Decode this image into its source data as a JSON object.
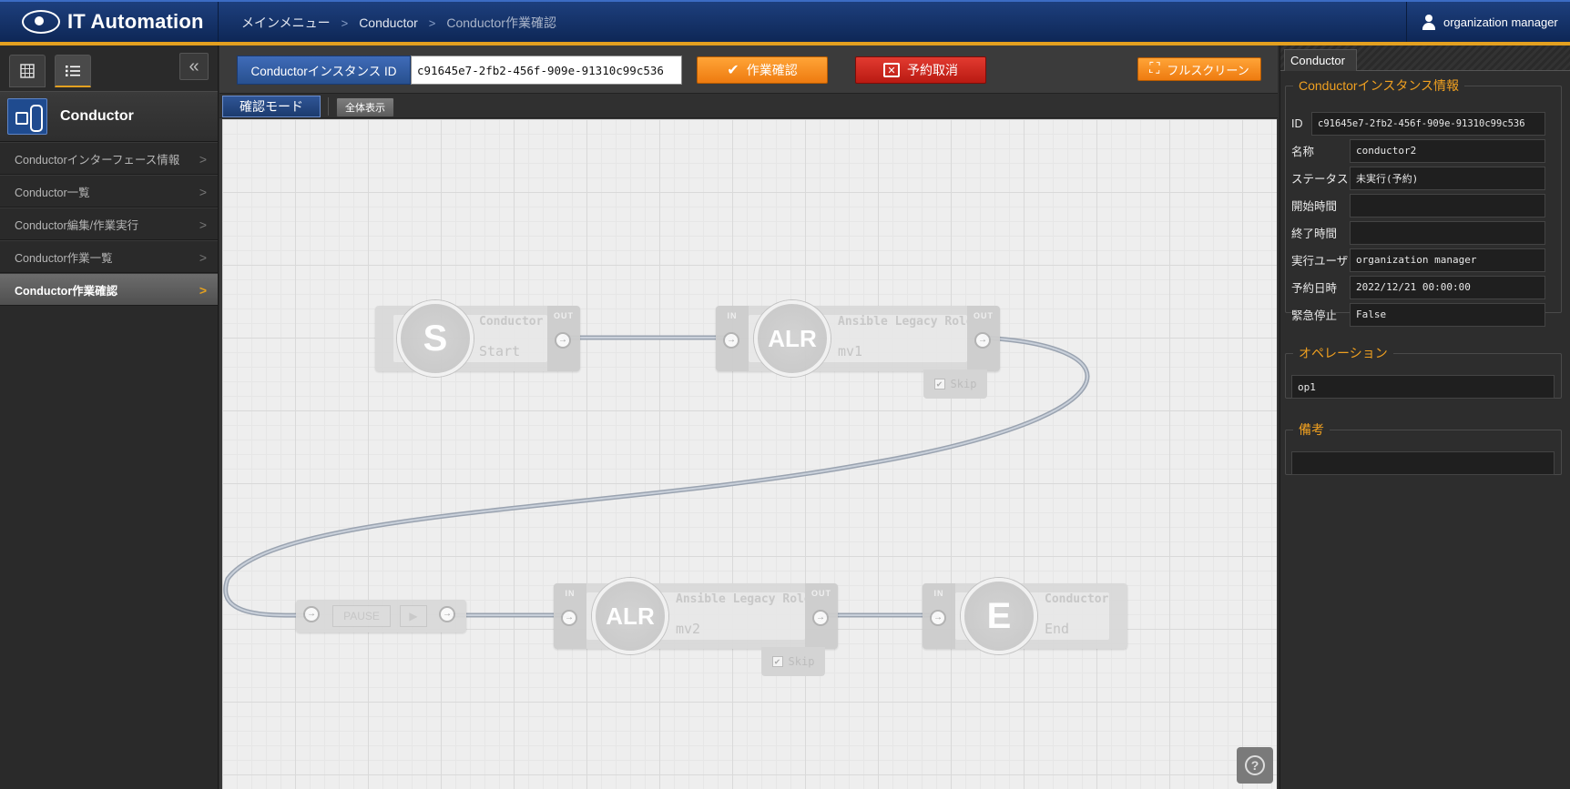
{
  "app": {
    "title": "IT Automation"
  },
  "header": {
    "breadcrumb": [
      "メインメニュー",
      "Conductor",
      "Conductor作業確認"
    ],
    "user": "organization manager"
  },
  "sidebar": {
    "group": "Conductor",
    "items": [
      {
        "label": "Conductorインターフェース情報",
        "active": false
      },
      {
        "label": "Conductor一覧",
        "active": false
      },
      {
        "label": "Conductor編集/作業実行",
        "active": false
      },
      {
        "label": "Conductor作業一覧",
        "active": false
      },
      {
        "label": "Conductor作業確認",
        "active": true
      }
    ]
  },
  "toolbar": {
    "id_label": "Conductorインスタンス ID",
    "id_value": "c91645e7-2fb2-456f-909e-91310c99c536",
    "confirm_label": "作業確認",
    "cancel_label": "予約取消",
    "fullscreen_label": "フルスクリーン",
    "mode_label": "確認モード",
    "fit_label": "全体表示"
  },
  "canvas": {
    "nodes": {
      "start": {
        "symbol": "S",
        "type": "Conductor",
        "name": "Start",
        "out": "OUT"
      },
      "mv1": {
        "symbol": "ALR",
        "type": "Ansible Legacy Role",
        "name": "mv1",
        "in": "IN",
        "out": "OUT",
        "skip": "Skip"
      },
      "pause": {
        "label": "PAUSE"
      },
      "mv2": {
        "symbol": "ALR",
        "type": "Ansible Legacy Role",
        "name": "mv2",
        "in": "IN",
        "out": "OUT",
        "skip": "Skip"
      },
      "end": {
        "symbol": "E",
        "type": "Conductor",
        "name": "End",
        "in": "IN"
      }
    },
    "help": "?"
  },
  "panel": {
    "tab": "Conductor",
    "info": {
      "legend": "Conductorインスタンス情報",
      "fields": [
        {
          "key": "ID",
          "value": "c91645e7-2fb2-456f-909e-91310c99c536"
        },
        {
          "key": "名称",
          "value": "conductor2"
        },
        {
          "key": "ステータス",
          "value": "未実行(予約)"
        },
        {
          "key": "開始時間",
          "value": ""
        },
        {
          "key": "終了時間",
          "value": ""
        },
        {
          "key": "実行ユーザ",
          "value": "organization manager"
        },
        {
          "key": "予約日時",
          "value": "2022/12/21 00:00:00"
        },
        {
          "key": "緊急停止",
          "value": "False"
        }
      ]
    },
    "operation": {
      "legend": "オペレーション",
      "value": "op1"
    },
    "note": {
      "legend": "備考",
      "value": ""
    }
  }
}
